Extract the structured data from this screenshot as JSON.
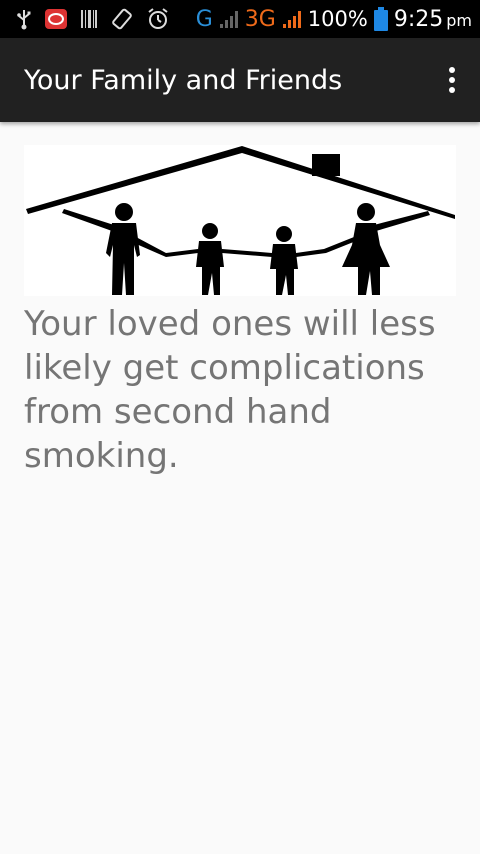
{
  "status_bar": {
    "network_g": "G",
    "network_3g": "3G",
    "battery": "100%",
    "time": "9:25",
    "ampm": "pm",
    "icons": [
      "usb-icon",
      "message-icon",
      "barcode-icon",
      "rotate-icon",
      "alarm-icon",
      "signal-icon",
      "battery-icon"
    ]
  },
  "app_bar": {
    "title": "Your Family and Friends",
    "overflow_icon": "more-vert-icon"
  },
  "content": {
    "image": "family-house-silhouette",
    "message": "Your loved ones will less likely get complications from second hand smoking."
  },
  "colors": {
    "app_bar": "#212121",
    "status_bar": "#000000",
    "background": "#fafafa",
    "message_text": "#757575",
    "signal_blue": "#2a8fd8",
    "signal_orange": "#ef6a1a",
    "battery_blue": "#1e88e5"
  }
}
